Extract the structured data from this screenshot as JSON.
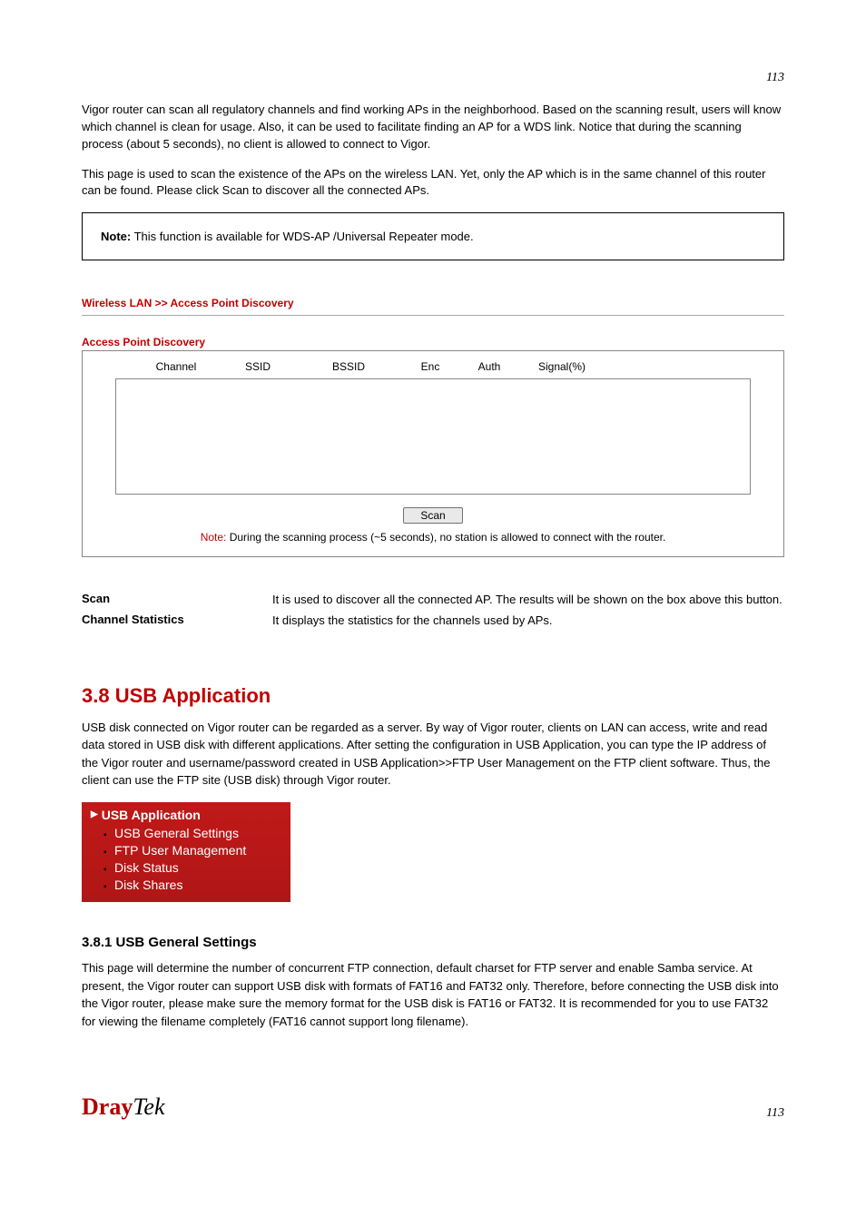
{
  "page_number": "113",
  "intro_paragraph": "Vigor router can scan all regulatory channels and find working APs in the neighborhood. Based on the scanning result, users will know which channel is clean for usage. Also, it can be used to facilitate finding an AP for a WDS link. Notice that during the scanning process (about 5 seconds), no client is allowed to connect to Vigor.",
  "intro_paragraph_2": "This page is used to scan the existence of the APs on the wireless LAN. Yet, only the AP which is in the same channel of this router can be found. Please click Scan to discover all the connected APs.",
  "noteBox": {
    "label": "Note:",
    "text": " This function is available for WDS-AP /Universal Repeater mode."
  },
  "breadcrumb": "Wireless LAN >> Access Point Discovery",
  "panelTitle": "Access Point Discovery",
  "columns": {
    "channel": "Channel",
    "ssid": "SSID",
    "bssid": "BSSID",
    "enc": "Enc",
    "auth": "Auth",
    "signal": "Signal(%)"
  },
  "scanButton": "Scan",
  "scanNote": {
    "red": "Note:",
    "rest": " During the scanning process (~5 seconds), no station is allowed to connect with the router."
  },
  "items": [
    {
      "label": "Scan",
      "desc": "It is used to discover all the connected AP. The results will be shown on the box above this button."
    },
    {
      "label": "Channel Statistics",
      "desc": "It displays the statistics for the channels used by APs."
    }
  ],
  "sectionHead": "3.8 USB Application",
  "sectionParas": [
    "USB disk connected on Vigor router can be regarded as a server. By way of Vigor router, clients on LAN can access, write and read data stored in USB disk with different applications. After setting the configuration in USB Application, you can type the IP address of the Vigor router and username/password created in USB Application>>FTP User Management on the FTP client software. Thus, the client can use the FTP site (USB disk) through Vigor router."
  ],
  "menu": {
    "title": "USB Application",
    "items": [
      "USB General Settings",
      "FTP User Management",
      "Disk Status",
      "Disk Shares"
    ]
  },
  "subsection": {
    "head": "3.8.1 USB General Settings",
    "para": "This page will determine the number of concurrent FTP connection, default charset for FTP server and enable Samba service. At present, the Vigor router can support USB disk with formats of FAT16 and FAT32 only. Therefore, before connecting the USB disk into the Vigor router, please make sure the memory format for the USB disk is FAT16 or FAT32. It is recommended for you to use FAT32 for viewing the filename completely (FAT16 cannot support long filename)."
  },
  "logo": {
    "part1": "Dray",
    "part2": "Tek"
  }
}
